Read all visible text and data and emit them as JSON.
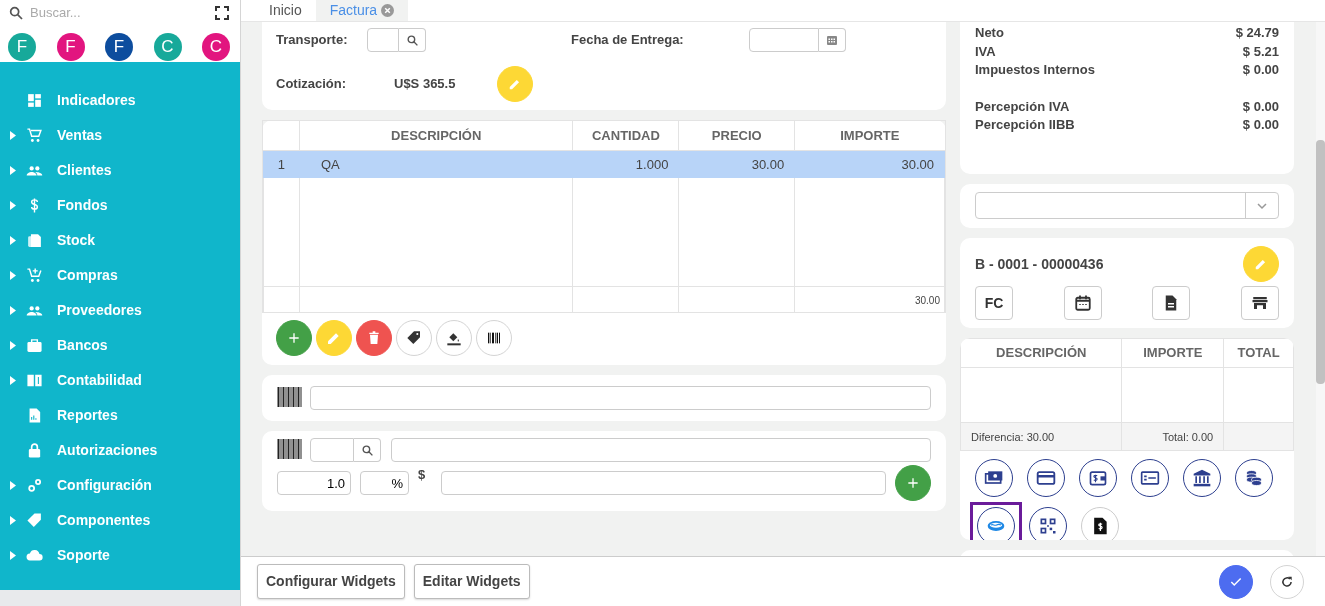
{
  "sidebar": {
    "search": {
      "placeholder": "Buscar..."
    },
    "avatars": [
      {
        "letter": "F",
        "color": "#17a99a"
      },
      {
        "letter": "F",
        "color": "#e2157f"
      },
      {
        "letter": "F",
        "color": "#0d4d9e"
      },
      {
        "letter": "C",
        "color": "#17a99a"
      },
      {
        "letter": "C",
        "color": "#e2157f"
      }
    ],
    "menu": [
      {
        "label": "Indicadores",
        "expandable": false
      },
      {
        "label": "Ventas",
        "expandable": true
      },
      {
        "label": "Clientes",
        "expandable": true
      },
      {
        "label": "Fondos",
        "expandable": true
      },
      {
        "label": "Stock",
        "expandable": true
      },
      {
        "label": "Compras",
        "expandable": true
      },
      {
        "label": "Proveedores",
        "expandable": true
      },
      {
        "label": "Bancos",
        "expandable": true
      },
      {
        "label": "Contabilidad",
        "expandable": true
      },
      {
        "label": "Reportes",
        "expandable": false
      },
      {
        "label": "Autorizaciones",
        "expandable": false
      },
      {
        "label": "Configuración",
        "expandable": true
      },
      {
        "label": "Componentes",
        "expandable": true
      },
      {
        "label": "Soporte",
        "expandable": true
      }
    ]
  },
  "tabs": [
    {
      "label": "Inicio",
      "selected": false,
      "closable": false
    },
    {
      "label": "Factura",
      "selected": true,
      "closable": true
    }
  ],
  "header_form": {
    "transporte_label": "Transporte:",
    "fecha_label": "Fecha de Entrega:",
    "cotizacion_label": "Cotización:",
    "cotizacion_value": "U$S 365.5"
  },
  "items_table": {
    "columns": [
      "",
      "DESCRIPCIÓN",
      "CANTIDAD",
      "PRECIO",
      "IMPORTE"
    ],
    "rows": [
      {
        "cells": [
          "1",
          "QA",
          "1.000",
          "30.00",
          "30.00"
        ],
        "selected": true
      }
    ],
    "footer_total": "30.00"
  },
  "quick_add": {
    "quantity": "1.0",
    "percent": "%",
    "currency": "$"
  },
  "totals": [
    {
      "lines": [
        {
          "label": "Neto",
          "amount": "$ 24.79"
        },
        {
          "label": "IVA",
          "amount": "$ 5.21"
        },
        {
          "label": "Impuestos Internos",
          "amount": "$ 0.00"
        }
      ]
    },
    {
      "lines": [
        {
          "label": "Percepción IVA",
          "amount": "$ 0.00"
        },
        {
          "label": "Percepción IIBB",
          "amount": "$ 0.00"
        }
      ]
    }
  ],
  "document": {
    "number": "B - 0001 - 00000436",
    "type_button": "FC"
  },
  "payments_table": {
    "columns": [
      "DESCRIPCIÓN",
      "IMPORTE",
      "TOTAL"
    ],
    "difference": "Diferencia: 30.00",
    "total": "Total: 0.00"
  },
  "payment_methods": [
    {
      "selected": false
    },
    {
      "selected": false
    },
    {
      "selected": false
    },
    {
      "selected": false
    },
    {
      "selected": false
    },
    {
      "selected": false
    },
    {
      "selected": true
    },
    {
      "selected": false
    },
    {
      "selected": false
    }
  ],
  "footer_buttons": [
    "Configurar Widgets",
    "Editar Widgets"
  ]
}
